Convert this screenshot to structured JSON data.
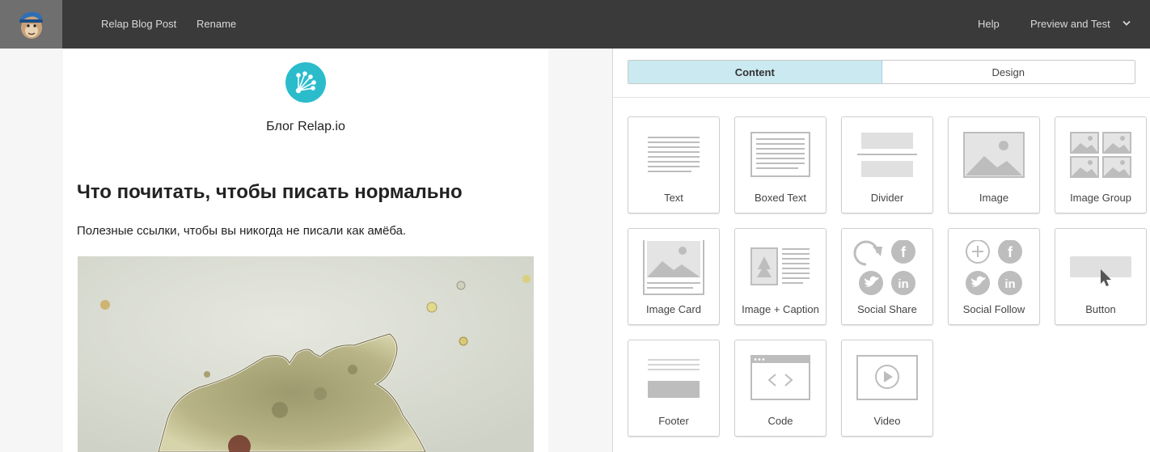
{
  "topbar": {
    "campaign_name": "Relap Blog Post",
    "rename": "Rename",
    "help": "Help",
    "preview": "Preview and Test"
  },
  "email": {
    "blog_name": "Блог Relap.io",
    "headline": "Что почитать, чтобы писать нормально",
    "lead": "Полезные ссылки, чтобы вы никогда не писали как амёба."
  },
  "panel": {
    "tabs": [
      {
        "label": "Content",
        "active": true
      },
      {
        "label": "Design",
        "active": false
      }
    ],
    "blocks": [
      {
        "label": "Text",
        "icon": "text-block-icon"
      },
      {
        "label": "Boxed Text",
        "icon": "boxed-text-icon"
      },
      {
        "label": "Divider",
        "icon": "divider-icon"
      },
      {
        "label": "Image",
        "icon": "image-icon"
      },
      {
        "label": "Image Group",
        "icon": "image-group-icon"
      },
      {
        "label": "Image Card",
        "icon": "image-card-icon"
      },
      {
        "label": "Image + Caption",
        "icon": "image-caption-icon"
      },
      {
        "label": "Social Share",
        "icon": "social-share-icon"
      },
      {
        "label": "Social Follow",
        "icon": "social-follow-icon"
      },
      {
        "label": "Button",
        "icon": "button-block-icon"
      },
      {
        "label": "Footer",
        "icon": "footer-icon"
      },
      {
        "label": "Code",
        "icon": "code-icon"
      },
      {
        "label": "Video",
        "icon": "video-icon"
      }
    ]
  },
  "colors": {
    "topbar": "#3a3a3a",
    "accent_tab": "#cbe9f1",
    "relap_teal": "#2bbccc",
    "icon_gray": "#bdbdbd"
  }
}
